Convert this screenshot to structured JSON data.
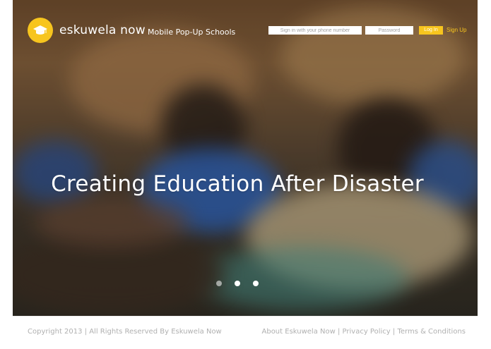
{
  "brand": {
    "name": "eskuwela now",
    "tagline": "Mobile Pop-Up Schools",
    "accent_color": "#f7c51e",
    "logo_icon": "graduation-cap-icon"
  },
  "login": {
    "phone_placeholder": "Sign in with your phone number",
    "password_placeholder": "Password",
    "login_label": "Log In",
    "signup_label": "Sign Up"
  },
  "hero": {
    "headline": "Creating Education After Disaster",
    "slides_total": 3,
    "active_slide": 2
  },
  "footer": {
    "copyright": "Copyright 2013 | All Rights Reserved By Eskuwela Now",
    "links": [
      "About Eskuwela Now",
      "Privacy Policy",
      "Terms & Conditions"
    ],
    "separator": "|"
  }
}
